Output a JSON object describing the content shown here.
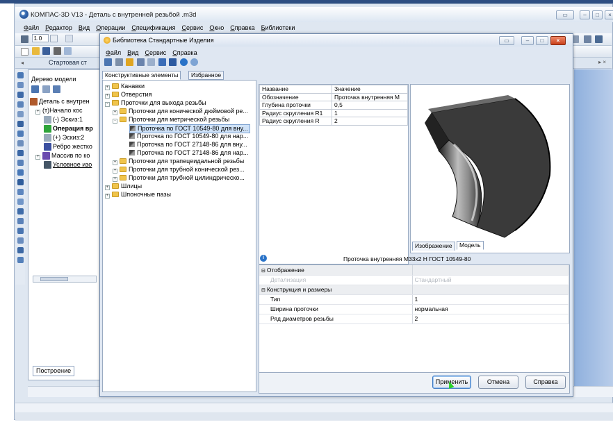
{
  "main": {
    "title": "КОМПАС-3D V13 - Деталь с внутренней резьбой .m3d",
    "menu": [
      "Файл",
      "Редактор",
      "Вид",
      "Операции",
      "Спецификация",
      "Сервис",
      "Окно",
      "Справка",
      "Библиотеки"
    ],
    "toolbar": {
      "scale_value": "1.0"
    },
    "start_tab": "Стартовая ст",
    "tree": {
      "title": "Дерево модели",
      "items": [
        {
          "label": "Деталь с внутрен",
          "bold": false
        },
        {
          "label": "(т)Начало кос",
          "bold": false
        },
        {
          "label": "(-) Эскиз:1",
          "bold": false
        },
        {
          "label": "Операция вр",
          "bold": true
        },
        {
          "label": "(+) Эскиз:2",
          "bold": false
        },
        {
          "label": "Ребро жестко",
          "bold": false
        },
        {
          "label": "Массив по ко",
          "bold": false
        },
        {
          "label": "Условное изо",
          "bold": false
        }
      ],
      "bottom_tab": "Построение"
    }
  },
  "dialog": {
    "title": "Библиотека Стандартные Изделия",
    "menu": [
      "Файл",
      "Вид",
      "Сервис",
      "Справка"
    ],
    "tabs": [
      "Конструктивные элементы",
      "Избранное"
    ],
    "tree": [
      {
        "label": "Канавки",
        "type": "folder",
        "level": 0,
        "pm": "+"
      },
      {
        "label": "Отверстия",
        "type": "folder",
        "level": 0,
        "pm": "+"
      },
      {
        "label": "Проточки для выхода резьбы",
        "type": "folder",
        "level": 0,
        "pm": "-"
      },
      {
        "label": "Проточки для конической дюймовой ре...",
        "type": "folder",
        "level": 1,
        "pm": "+"
      },
      {
        "label": "Проточки для метрической резьбы",
        "type": "folder",
        "level": 1,
        "pm": "-"
      },
      {
        "label": "Проточка по ГОСТ 10549-80 для вну...",
        "type": "item",
        "level": 2,
        "selected": true
      },
      {
        "label": "Проточка по ГОСТ 10549-80 для нар...",
        "type": "item",
        "level": 2
      },
      {
        "label": "Проточка по ГОСТ 27148-86 для вну...",
        "type": "item",
        "level": 2
      },
      {
        "label": "Проточка по ГОСТ 27148-86 для нар...",
        "type": "item",
        "level": 2
      },
      {
        "label": "Проточки для трапецеидальной резьбы",
        "type": "folder",
        "level": 1,
        "pm": "+"
      },
      {
        "label": "Проточки для трубной конической рез...",
        "type": "folder",
        "level": 1,
        "pm": "+"
      },
      {
        "label": "Проточки для трубной цилиндрическо...",
        "type": "folder",
        "level": 1,
        "pm": "+"
      },
      {
        "label": "Шлицы",
        "type": "folder",
        "level": 0,
        "pm": "+"
      },
      {
        "label": "Шпоночные пазы",
        "type": "folder",
        "level": 0,
        "pm": "+"
      }
    ],
    "props": {
      "headers": [
        "Название",
        "Значение"
      ],
      "rows": [
        [
          "Обозначение",
          "Проточка внутренняя М"
        ],
        [
          "Глубина проточки",
          "0,5"
        ],
        [
          "Радиус скругления R1",
          "1"
        ],
        [
          "Радиус скругления R",
          "2"
        ]
      ]
    },
    "preview_tabs": [
      "Изображение",
      "Модель"
    ],
    "info_text": "Проточка внутренняя М33х2 Н ГОСТ 10549-80",
    "settings": [
      {
        "label": "Отображение",
        "value": "",
        "category": true
      },
      {
        "label": "Детализация",
        "value": "Стандартный",
        "disabled": true
      },
      {
        "label": "Конструкция и размеры",
        "value": "",
        "category": true
      },
      {
        "label": "Тип",
        "value": "1"
      },
      {
        "label": "Ширина проточки",
        "value": "нормальная"
      },
      {
        "label": "Ряд диаметров резьбы",
        "value": "2"
      }
    ],
    "buttons": {
      "apply": "Применить",
      "cancel": "Отмена",
      "help": "Справка"
    }
  },
  "colors": {
    "titlebar_dark": "#2e4e82",
    "selection": "#cfe2f8",
    "close_red": "#c8401a"
  }
}
